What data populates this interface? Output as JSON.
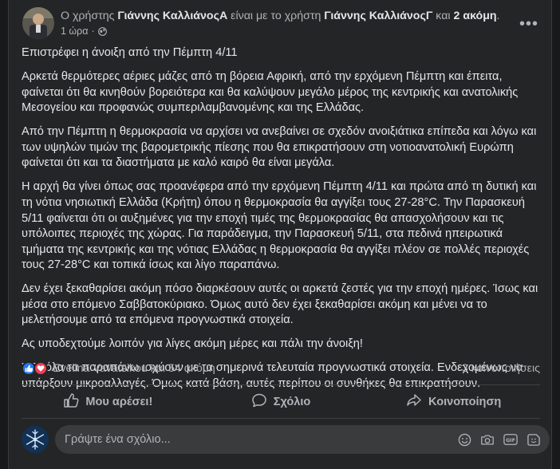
{
  "header": {
    "prefix": "Ο χρήστης ",
    "author": "Γιάννης ΚαλλιάνοςΑ",
    "middle": " είναι με το χρήστη ",
    "tagged": "Γιάννης ΚαλλιάνοςΓ",
    "and": " και ",
    "others": "2 ακόμη",
    "period": ".",
    "time": "1 ώρα",
    "dot": "·",
    "privacy_icon": "globe-icon"
  },
  "post": {
    "paragraphs": [
      "Επιστρέφει η άνοιξη από την Πέμπτη 4/11",
      "Αρκετά θερμότερες αέριες μάζες από τη βόρεια Αφρική, από την ερχόμενη Πέμπτη και έπειτα, φαίνεται ότι θα κινηθούν βορειότερα και θα καλύψουν μεγάλο μέρος της κεντρικής και ανατολικής Μεσογείου και προφανώς συμπεριλαμβανομένης και της Ελλάδας.",
      "Από την Πέμπτη η θερμοκρασία να αρχίσει να ανεβαίνει σε σχεδόν ανοιξιάτικα επίπεδα και λόγω και των υψηλών τιμών της βαρομετρικής πίεσης που θα επικρατήσουν στη νοτιοανατολική Ευρώπη φαίνεται ότι και τα διαστήματα με καλό καιρό θα είναι μεγάλα.",
      "Η αρχή θα γίνει όπως σας προανέφερα από την ερχόμενη Πέμπτη 4/11 και πρώτα από τη δυτική και τη νότια νησιωτική Ελλάδα (Κρήτη) όπου η θερμοκρασία θα αγγίξει τους 27-28°C. Την Παρασκευή 5/11 φαίνεται ότι οι αυξημένες για την εποχή τιμές της θερμοκρασίας θα απασχολήσουν και τις υπόλοιπες περιοχές της χώρας. Για παράδειγμα, την Παρασκευή 5/11, στα πεδινά ηπειρωτικά τμήματα της κεντρικής και της νότιας Ελλάδας η θερμοκρασία θα αγγίξει πλέον σε πολλές περιοχές τους 27-28°C και τοπικά ίσως και λίγο παραπάνω.",
      "Δεν έχει ξεκαθαρίσει ακόμη πόσο διαρκέσουν αυτές οι αρκετά ζεστές για την εποχή ημέρες. Ίσως και μέσα στο επόμενο Σαββατοκύριακο. Όμως αυτό δεν έχει ξεκαθαρίσει ακόμη και μένει να το μελετήσουμε από τα επόμενα προγνωστικά στοιχεία.",
      "Ας υποδεχτούμε λοιπόν για λίγες ακόμη μέρες και πάλι την άνοιξη!",
      "ΥΓ : όλα τα παραπάνω ισχύουν με τα σημερινά τελευταία προγνωστικά στοιχεία. Ενδεχομένως να υπάρξουν μικροαλλαγές. Όμως κατά βάση, αυτές περίπου οι συνθήκες θα επικρατήσουν."
    ]
  },
  "reactions": {
    "icons": [
      "like-icon",
      "love-icon"
    ],
    "names": "Evelina Vavatsikou και 54 ακόμη",
    "shares": "3 κοινοποιήσεις"
  },
  "actions": {
    "like": "Μου αρέσει!",
    "comment": "Σχόλιο",
    "share": "Κοινοποίηση"
  },
  "comment": {
    "placeholder": "Γράψτε ένα σχόλιο...",
    "icons": [
      "emoji-icon",
      "camera-icon",
      "gif-icon",
      "sticker-icon"
    ]
  },
  "colors": {
    "card_bg": "#242526",
    "text": "#e4e6eb",
    "secondary_text": "#b0b3b8",
    "like_blue": "#2078f4",
    "love_red": "#f33e58"
  }
}
